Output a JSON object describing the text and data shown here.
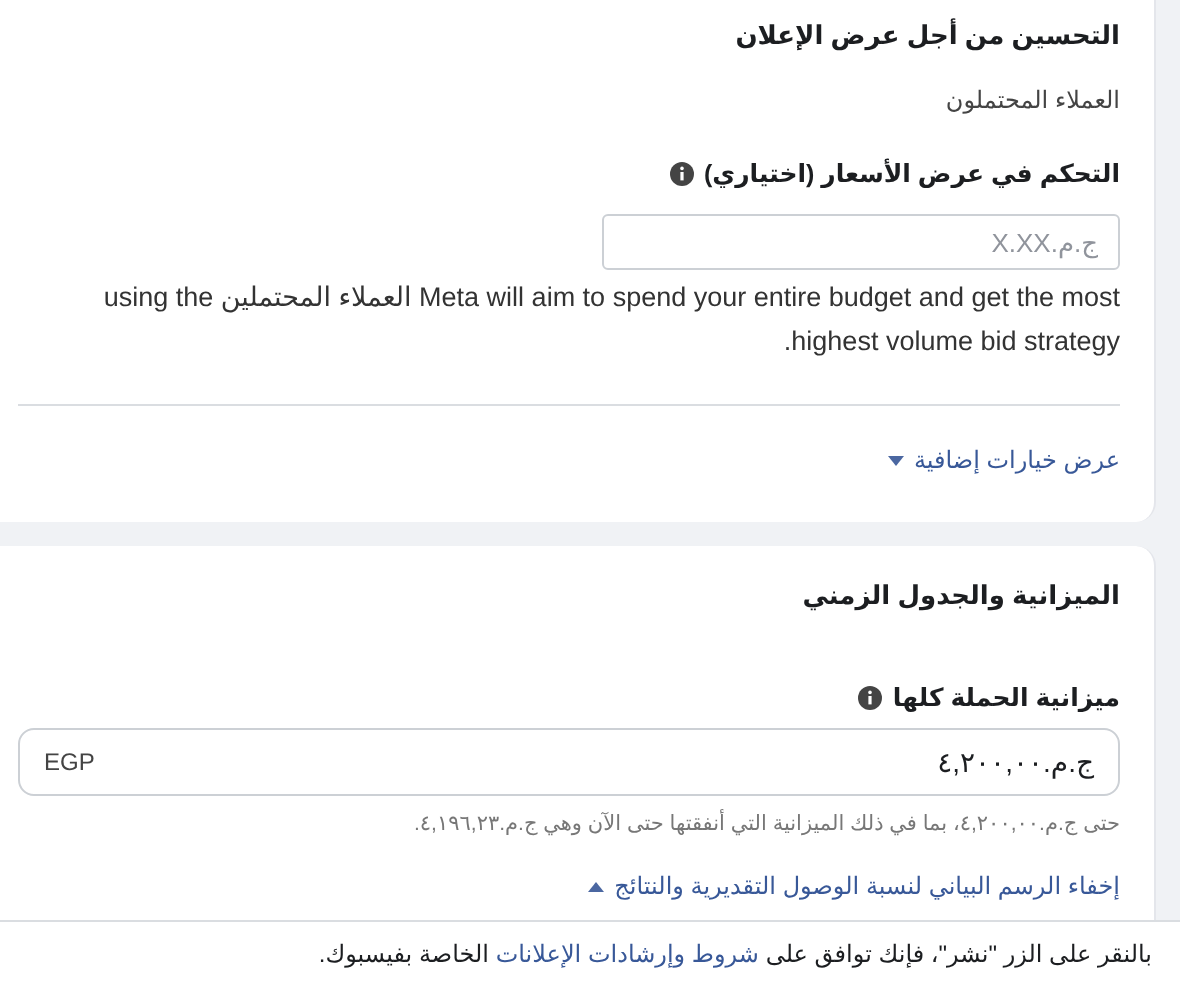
{
  "optimization_section": {
    "title": "التحسين من أجل عرض الإعلان",
    "value": "العملاء المحتملون",
    "bid_control": {
      "label": "التحكم في عرض الأسعار (اختياري)",
      "info_icon": true,
      "placeholder": "ج.م.X.XX"
    },
    "description": "Meta will aim to spend your entire budget and get the most العملاء المحتملين using the highest volume bid strategy.",
    "more_options_link": {
      "label": "عرض خيارات إضافية",
      "expanded": false
    }
  },
  "budget_section": {
    "title": "الميزانية والجدول الزمني",
    "campaign_budget": {
      "label": "ميزانية الحملة كلها",
      "info_icon": true,
      "value": "ج.م.٤,٢٠٠,٠٠",
      "currency": "EGP"
    },
    "hint": "حتى ج.م.٤,٢٠٠,٠٠، بما في ذلك الميزانية التي أنفقتها حتى الآن وهي ج.م.٤,١٩٦,٢٣.",
    "chart_link": {
      "label": "إخفاء الرسم البياني لنسبة الوصول التقديرية والنتائج",
      "expanded": true
    }
  },
  "footer": {
    "before": "بالنقر على الزر \"نشر\"، فإنك توافق على",
    "link": "شروط وإرشادات الإعلانات",
    "after": "الخاصة بفيسبوك."
  }
}
